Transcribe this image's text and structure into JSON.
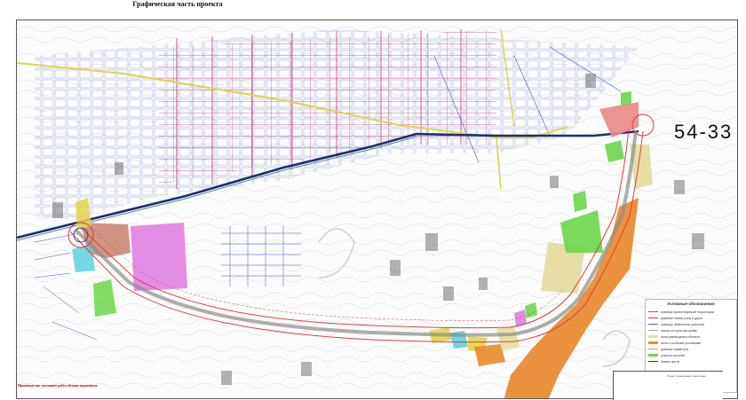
{
  "page": {
    "heading": "Графическая часть проекта"
  },
  "map": {
    "sheet_number": "54-33",
    "warning_note": "Производство земляных работ вблизи надземных",
    "colors": {
      "railway": "#1a2f6e",
      "road_red": "#d64040",
      "street_magenta": "#c13b78",
      "street_blue": "#4a55c8",
      "main_road_yellow": "#e3d34a",
      "contour": "#9aa2a8",
      "zone_orange": "#e8892e",
      "zone_green": "#6cd64a",
      "zone_pink": "#e07fe0",
      "zone_brown": "#c98a74",
      "zone_khaki": "#e6dca0",
      "zone_salmon": "#e88a86",
      "zone_cyan": "#5fd0e0"
    },
    "legend": {
      "title": "Условные обозначения",
      "items": [
        {
          "label": "граница проектируемой территории",
          "color": "#d64040",
          "kind": "line"
        },
        {
          "label": "красные линии улиц и дорог",
          "color": "#c13b78",
          "kind": "line"
        },
        {
          "label": "границы земельных участков",
          "color": "#4a55c8",
          "kind": "line"
        },
        {
          "label": "линия отступа застройки",
          "color": "#9aa2a8",
          "kind": "line"
        },
        {
          "label": "зона размещения объекта",
          "color": "#e6dca0",
          "kind": "area"
        },
        {
          "label": "зона с особыми условиями",
          "color": "#e8892e",
          "kind": "area"
        },
        {
          "label": "граница сервитута",
          "color": "#e88a86",
          "kind": "line"
        },
        {
          "label": "участок изъятия",
          "color": "#6cd64a",
          "kind": "area"
        },
        {
          "label": "номер листа",
          "color": "#1a2f6e",
          "kind": "line"
        }
      ]
    },
    "stamp": {
      "text": "Проект планировки территории"
    }
  }
}
